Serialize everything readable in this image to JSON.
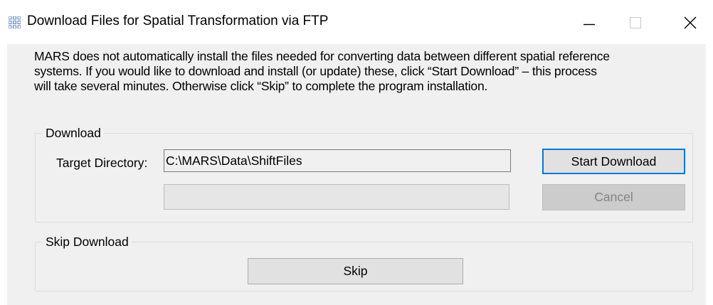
{
  "window": {
    "title": "Download Files for Spatial Transformation via FTP",
    "app_icon": "grid-app-icon",
    "controls": {
      "minimize_icon": "minimize-icon",
      "maximize_icon": "maximize-icon",
      "close_icon": "close-icon"
    }
  },
  "message": {
    "line1": "MARS does not automatically install the files needed for converting data between different spatial reference",
    "line2": "systems.  If you would like to download and install (or update) these, click “Start Download” – this process",
    "line3": "will take several minutes.  Otherwise click “Skip” to complete the program installation."
  },
  "download_group": {
    "legend": "Download",
    "target_label": "Target Directory:",
    "target_value": "C:\\MARS\\Data\\ShiftFiles",
    "progress_percent": 0,
    "start_label": "Start Download",
    "cancel_label": "Cancel",
    "cancel_enabled": false
  },
  "skip_group": {
    "legend": "Skip Download",
    "skip_label": "Skip"
  },
  "colors": {
    "focus_border": "#0078d7",
    "client_background": "#f0f0f0",
    "disabled_text": "#838383"
  }
}
